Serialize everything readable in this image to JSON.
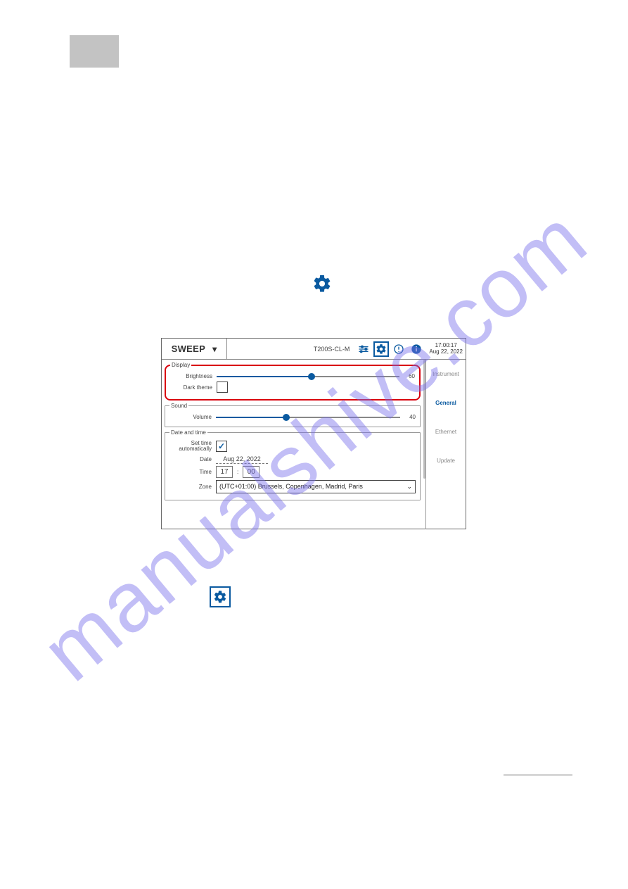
{
  "watermark": "manualshive.com",
  "topbar": {
    "mode": "SWEEP",
    "device": "T200S-CL-M",
    "time": "17:00:17",
    "date": "Aug 22, 2022"
  },
  "sidebar": {
    "items": [
      "Instrument",
      "General",
      "Ethernet",
      "Update"
    ],
    "selected": "General"
  },
  "display": {
    "legend": "Display",
    "brightness_label": "Brightness",
    "brightness_value": "60",
    "brightness_pct": 52,
    "dark_label": "Dark theme"
  },
  "sound": {
    "legend": "Sound",
    "volume_label": "Volume",
    "volume_value": "40",
    "volume_pct": 38
  },
  "datetime": {
    "legend": "Date and time",
    "auto_label_1": "Set time",
    "auto_label_2": "automatically",
    "auto_checked": "✓",
    "date_label": "Date",
    "date_value": "Aug 22, 2022",
    "time_label": "Time",
    "time_hh": "17",
    "time_mm": "00",
    "time_sep": ":",
    "zone_label": "Zone",
    "zone_value": "(UTC+01:00) Brussels, Copenhagen, Madrid, Paris",
    "zone_caret": "⌄"
  }
}
